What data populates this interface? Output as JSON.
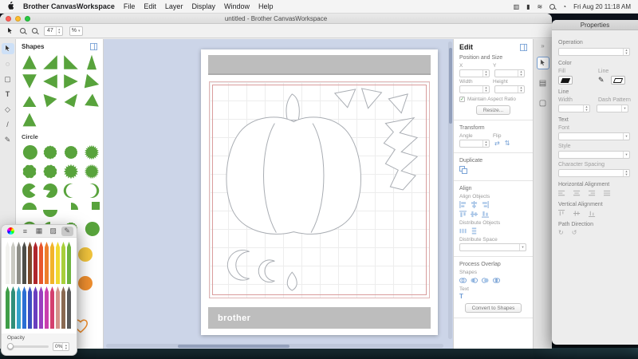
{
  "menu_bar": {
    "app_name": "Brother CanvasWorkspace",
    "items": [
      "File",
      "Edit",
      "Layer",
      "Display",
      "Window",
      "Help"
    ],
    "clock": "Fri Aug 20 11:18 AM"
  },
  "window": {
    "title": "untitled - Brother CanvasWorkspace",
    "toolbar": {
      "zoom_value": "47",
      "zoom_unit": "%"
    }
  },
  "shapes_panel": {
    "title": "Shapes",
    "circle_section": "Circle",
    "shape_color": "#58a33c",
    "triangles": [
      "50,6 94,94 6,94",
      "94,6 94,94 6,94",
      "6,6 94,94 6,94",
      "50,4 80,96 20,96",
      "6,6 94,6 50,94",
      "6,50 94,6 94,94",
      "6,6 94,50 6,94",
      "20,4 96,70 4,92",
      "50,22 92,90 8,90",
      "8,10 92,40 28,92",
      "90,8 70,92 8,60",
      "6,80 55,8 94,88",
      "50,8 92,92 8,92"
    ],
    "circles": [
      {
        "t": "circle"
      },
      {
        "t": "scallop",
        "n": 14
      },
      {
        "t": "scallop",
        "n": 20
      },
      {
        "t": "burst",
        "n": 20
      },
      {
        "t": "scallop",
        "n": 8
      },
      {
        "t": "scallop",
        "n": 11
      },
      {
        "t": "burst",
        "n": 16
      },
      {
        "t": "burst",
        "n": 28
      },
      {
        "t": "pac",
        "a1": 0.6,
        "a2": -0.6
      },
      {
        "t": "pac",
        "a1": 3.3,
        "a2": 2.2
      },
      {
        "t": "crescent",
        "d": "r"
      },
      {
        "t": "crescent",
        "d": "l"
      },
      {
        "t": "half",
        "o": "t"
      },
      {
        "t": "half",
        "o": "b"
      },
      {
        "t": "quarter"
      },
      {
        "t": "pac",
        "a1": -1.57,
        "a2": 0
      },
      {
        "t": "crescent",
        "d": "u"
      },
      {
        "t": "half",
        "o": "l"
      },
      {
        "t": "scallop",
        "n": 16
      },
      {
        "t": "circle"
      }
    ],
    "extra": [
      {
        "name": "circle-yellow",
        "color": "#f2c53d"
      },
      {
        "name": "circle-orange",
        "color": "#ef8e2e"
      },
      {
        "name": "heart-orange",
        "color": "#ef8e2e"
      }
    ]
  },
  "canvas": {
    "brand": "brother"
  },
  "edit_panel": {
    "title": "Edit",
    "position_size": {
      "header": "Position and Size",
      "x": "X",
      "y": "Y",
      "width": "Width",
      "height": "Height",
      "aspect": "Maintain Aspect Ratio",
      "resize": "Resize..."
    },
    "transform": {
      "header": "Transform",
      "angle": "Angle",
      "flip": "Flip"
    },
    "duplicate": {
      "header": "Duplicate"
    },
    "align": {
      "header": "Align",
      "objects": "Align Objects",
      "distribute": "Distribute Objects",
      "space": "Distribute Space"
    },
    "overlap": {
      "header": "Process Overlap",
      "shapes": "Shapes",
      "text": "Text",
      "convert": "Convert to Shapes"
    }
  },
  "properties_panel": {
    "title": "Properties",
    "operation": "Operation",
    "color": {
      "header": "Color",
      "fill": "Fill",
      "line": "Line"
    },
    "line": {
      "header": "Line",
      "width": "Width",
      "dash": "Dash Pattern"
    },
    "text": {
      "header": "Text",
      "font": "Font",
      "style": "Style",
      "spacing": "Character Spacing",
      "halign": "Horizontal Alignment",
      "valign": "Vertical Alignment",
      "path": "Path Direction"
    }
  },
  "color_picker": {
    "opacity_label": "Opacity",
    "opacity_value": "0%",
    "pencils_row1": [
      "#f2f2ef",
      "#c9c9c2",
      "#8f8f88",
      "#4d4d48",
      "#7a4a2b",
      "#b0262c",
      "#e8562c",
      "#ed7d2b",
      "#f2b32a",
      "#f0d930",
      "#a8cf3a",
      "#6db33f"
    ],
    "pencils_row2": [
      "#3f9e48",
      "#2f8f7a",
      "#35a3c9",
      "#2a6fd4",
      "#3b4fc0",
      "#6a3fbf",
      "#9b3fbf",
      "#c93fae",
      "#d43f6e",
      "#d4938a",
      "#8a6a52",
      "#5a5a5a"
    ]
  },
  "accent": {
    "blue": "#7aa3d6",
    "green": "#58a33c"
  }
}
